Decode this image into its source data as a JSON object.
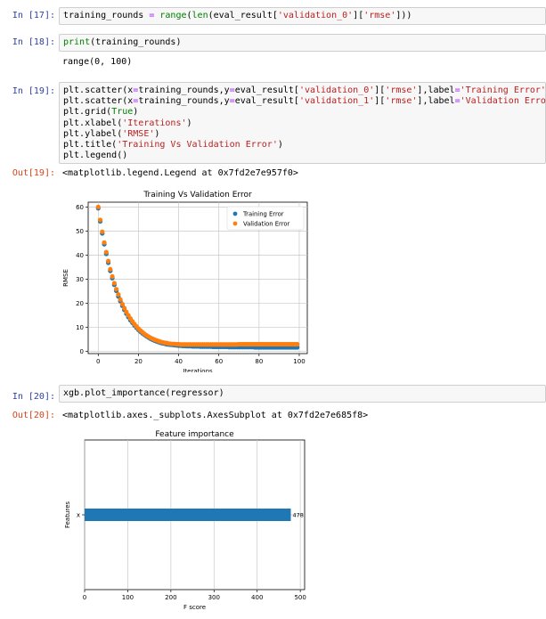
{
  "cells": {
    "c17": {
      "prompt": "In [17]:",
      "code": [
        [
          [
            "n",
            "training_rounds "
          ],
          [
            "o",
            "="
          ],
          [
            "n",
            " "
          ],
          [
            "k",
            "range"
          ],
          [
            "n",
            "("
          ],
          [
            "k",
            "len"
          ],
          [
            "n",
            "(eval_result["
          ],
          [
            "s",
            "'validation_0'"
          ],
          [
            "n",
            "]["
          ],
          [
            "s",
            "'rmse'"
          ],
          [
            "n",
            "]))"
          ]
        ]
      ]
    },
    "c18": {
      "prompt": "In [18]:",
      "code": [
        [
          [
            "k",
            "print"
          ],
          [
            "n",
            "(training_rounds)"
          ]
        ]
      ],
      "output": "range(0, 100)"
    },
    "c19": {
      "prompt": "In [19]:",
      "code": [
        [
          [
            "n",
            "plt.scatter(x"
          ],
          [
            "o",
            "="
          ],
          [
            "n",
            "training_rounds,y"
          ],
          [
            "o",
            "="
          ],
          [
            "n",
            "eval_result["
          ],
          [
            "s",
            "'validation_0'"
          ],
          [
            "n",
            "]["
          ],
          [
            "s",
            "'rmse'"
          ],
          [
            "n",
            "],label"
          ],
          [
            "o",
            "="
          ],
          [
            "s",
            "'Training Error'"
          ],
          [
            "n",
            ")"
          ]
        ],
        [
          [
            "n",
            "plt.scatter(x"
          ],
          [
            "o",
            "="
          ],
          [
            "n",
            "training_rounds,y"
          ],
          [
            "o",
            "="
          ],
          [
            "n",
            "eval_result["
          ],
          [
            "s",
            "'validation_1'"
          ],
          [
            "n",
            "]["
          ],
          [
            "s",
            "'rmse'"
          ],
          [
            "n",
            "],label"
          ],
          [
            "o",
            "="
          ],
          [
            "s",
            "'Validation Error'"
          ],
          [
            "n",
            ")"
          ]
        ],
        [
          [
            "n",
            "plt.grid("
          ],
          [
            "k",
            "True"
          ],
          [
            "n",
            ")"
          ]
        ],
        [
          [
            "n",
            "plt.xlabel("
          ],
          [
            "s",
            "'Iterations'"
          ],
          [
            "n",
            ")"
          ]
        ],
        [
          [
            "n",
            "plt.ylabel("
          ],
          [
            "s",
            "'RMSE'"
          ],
          [
            "n",
            ")"
          ]
        ],
        [
          [
            "n",
            "plt.title("
          ],
          [
            "s",
            "'Training Vs Validation Error'"
          ],
          [
            "n",
            ")"
          ]
        ],
        [
          [
            "n",
            "plt.legend()"
          ]
        ]
      ],
      "out_prompt": "Out[19]:",
      "output": "<matplotlib.legend.Legend at 0x7fd2e7e957f0>"
    },
    "c20": {
      "prompt": "In [20]:",
      "code": [
        [
          [
            "n",
            "xgb.plot_importance(regressor)"
          ]
        ]
      ],
      "out_prompt": "Out[20]:",
      "output": "<matplotlib.axes._subplots.AxesSubplot at 0x7fd2e7e685f8>"
    }
  },
  "colors": {
    "train": "#1f77b4",
    "val": "#ff7f0e",
    "bar": "#1f77b4"
  },
  "chart_data": [
    {
      "type": "scatter",
      "title": "Training Vs Validation Error",
      "xlabel": "Iterations",
      "ylabel": "RMSE",
      "xlim": [
        -5,
        104
      ],
      "ylim": [
        -1,
        62
      ],
      "xticks": [
        0,
        20,
        40,
        60,
        80,
        100
      ],
      "yticks": [
        0,
        10,
        20,
        30,
        40,
        50,
        60
      ],
      "grid": true,
      "legend": "top-right",
      "series": [
        {
          "name": "Training Error",
          "color": "#1f77b4",
          "x_start": 0,
          "x_end": 99,
          "y": [
            59.5,
            54.0,
            49.0,
            44.5,
            40.5,
            36.8,
            33.4,
            30.4,
            27.6,
            25.1,
            22.8,
            20.8,
            18.9,
            17.2,
            15.6,
            14.2,
            12.9,
            11.8,
            10.7,
            9.8,
            8.9,
            8.1,
            7.4,
            6.8,
            6.2,
            5.7,
            5.2,
            4.8,
            4.4,
            4.1,
            3.8,
            3.5,
            3.3,
            3.1,
            2.9,
            2.8,
            2.7,
            2.6,
            2.5,
            2.4,
            2.3,
            2.3,
            2.2,
            2.2,
            2.1,
            2.1,
            2.1,
            2.0,
            2.0,
            2.0,
            2.0,
            1.9,
            1.9,
            1.9,
            1.9,
            1.9,
            1.9,
            1.8,
            1.8,
            1.8,
            1.8,
            1.8,
            1.8,
            1.8,
            1.8,
            1.7,
            1.7,
            1.7,
            1.7,
            1.7,
            1.7,
            1.7,
            1.7,
            1.7,
            1.7,
            1.7,
            1.7,
            1.7,
            1.6,
            1.6,
            1.6,
            1.6,
            1.6,
            1.6,
            1.6,
            1.6,
            1.6,
            1.6,
            1.6,
            1.6,
            1.6,
            1.6,
            1.6,
            1.6,
            1.6,
            1.6,
            1.6,
            1.6,
            1.6,
            1.6
          ]
        },
        {
          "name": "Validation Error",
          "color": "#ff7f0e",
          "x_start": 0,
          "x_end": 99,
          "y": [
            60.0,
            54.6,
            49.7,
            45.2,
            41.2,
            37.5,
            34.1,
            31.1,
            28.3,
            25.8,
            23.6,
            21.5,
            19.6,
            17.9,
            16.3,
            14.9,
            13.6,
            12.4,
            11.3,
            10.3,
            9.4,
            8.6,
            7.9,
            7.2,
            6.6,
            6.1,
            5.6,
            5.2,
            4.8,
            4.5,
            4.2,
            3.9,
            3.7,
            3.5,
            3.4,
            3.2,
            3.1,
            3.0,
            3.0,
            2.9,
            2.9,
            2.8,
            2.8,
            2.8,
            2.8,
            2.8,
            2.8,
            2.8,
            2.8,
            2.8,
            2.8,
            2.8,
            2.8,
            2.8,
            2.8,
            2.8,
            2.8,
            2.8,
            2.8,
            2.8,
            2.8,
            2.8,
            2.8,
            2.8,
            2.8,
            2.8,
            2.8,
            2.8,
            2.8,
            2.8,
            2.9,
            2.9,
            2.9,
            2.9,
            2.9,
            2.9,
            2.9,
            2.9,
            2.9,
            2.9,
            2.9,
            2.9,
            2.9,
            2.9,
            2.9,
            2.9,
            2.9,
            2.9,
            2.9,
            2.9,
            2.9,
            2.9,
            2.9,
            2.9,
            2.9,
            2.9,
            2.9,
            2.9,
            2.9,
            2.9
          ]
        }
      ]
    },
    {
      "type": "bar",
      "orientation": "horizontal",
      "title": "Feature importance",
      "xlabel": "F score",
      "ylabel": "Features",
      "categories": [
        "x"
      ],
      "values": [
        478
      ],
      "xlim": [
        0,
        510
      ],
      "xticks": [
        0,
        100,
        200,
        300,
        400,
        500
      ],
      "grid": true
    }
  ]
}
